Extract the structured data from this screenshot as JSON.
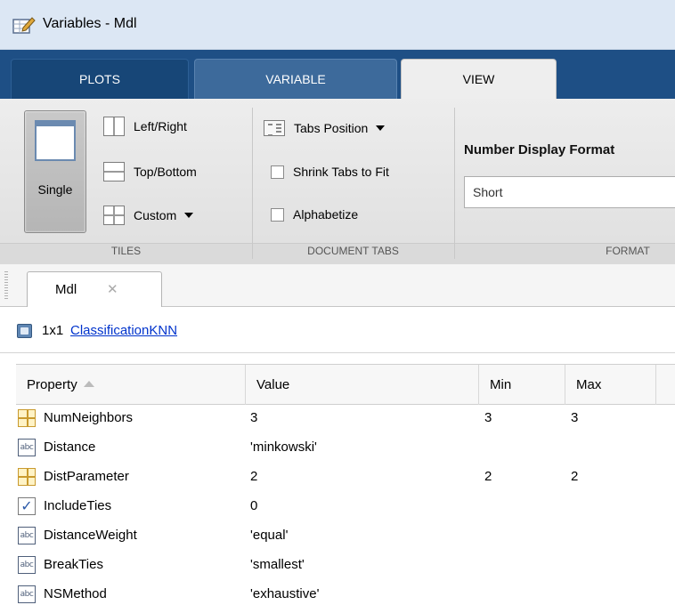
{
  "window": {
    "title": "Variables - Mdl",
    "icon": "edit-variable-icon"
  },
  "ribbon_tabs": [
    "PLOTS",
    "VARIABLE",
    "VIEW"
  ],
  "tiles": {
    "single_label": "Single",
    "left_right": "Left/Right",
    "top_bottom": "Top/Bottom",
    "custom": "Custom",
    "group_label": "TILES"
  },
  "document_tabs": {
    "tabs_position": "Tabs Position",
    "shrink_tabs": "Shrink Tabs to Fit",
    "alphabetize": "Alphabetize",
    "group_label": "DOCUMENT TABS"
  },
  "format": {
    "label": "Number Display Format",
    "value": "Short",
    "group_label": "FORMAT"
  },
  "doc_tab": {
    "label": "Mdl",
    "close": "✕"
  },
  "info": {
    "size": "1x1",
    "class_name": "ClassificationKNN"
  },
  "table": {
    "columns": [
      "Property",
      "Value",
      "Min",
      "Max"
    ],
    "rows": [
      {
        "icon": "numeric",
        "property": "NumNeighbors",
        "value": "3",
        "min": "3",
        "max": "3"
      },
      {
        "icon": "char",
        "property": "Distance",
        "value": "'minkowski'",
        "min": "",
        "max": ""
      },
      {
        "icon": "numeric",
        "property": "DistParameter",
        "value": "2",
        "min": "2",
        "max": "2"
      },
      {
        "icon": "logical",
        "property": "IncludeTies",
        "value": "0",
        "min": "",
        "max": ""
      },
      {
        "icon": "char",
        "property": "DistanceWeight",
        "value": "'equal'",
        "min": "",
        "max": ""
      },
      {
        "icon": "char",
        "property": "BreakTies",
        "value": "'smallest'",
        "min": "",
        "max": ""
      },
      {
        "icon": "char",
        "property": "NSMethod",
        "value": "'exhaustive'",
        "min": "",
        "max": ""
      }
    ]
  },
  "colors": {
    "ribbon_tab_bar": "#1e4f85",
    "link": "#0033cc"
  }
}
